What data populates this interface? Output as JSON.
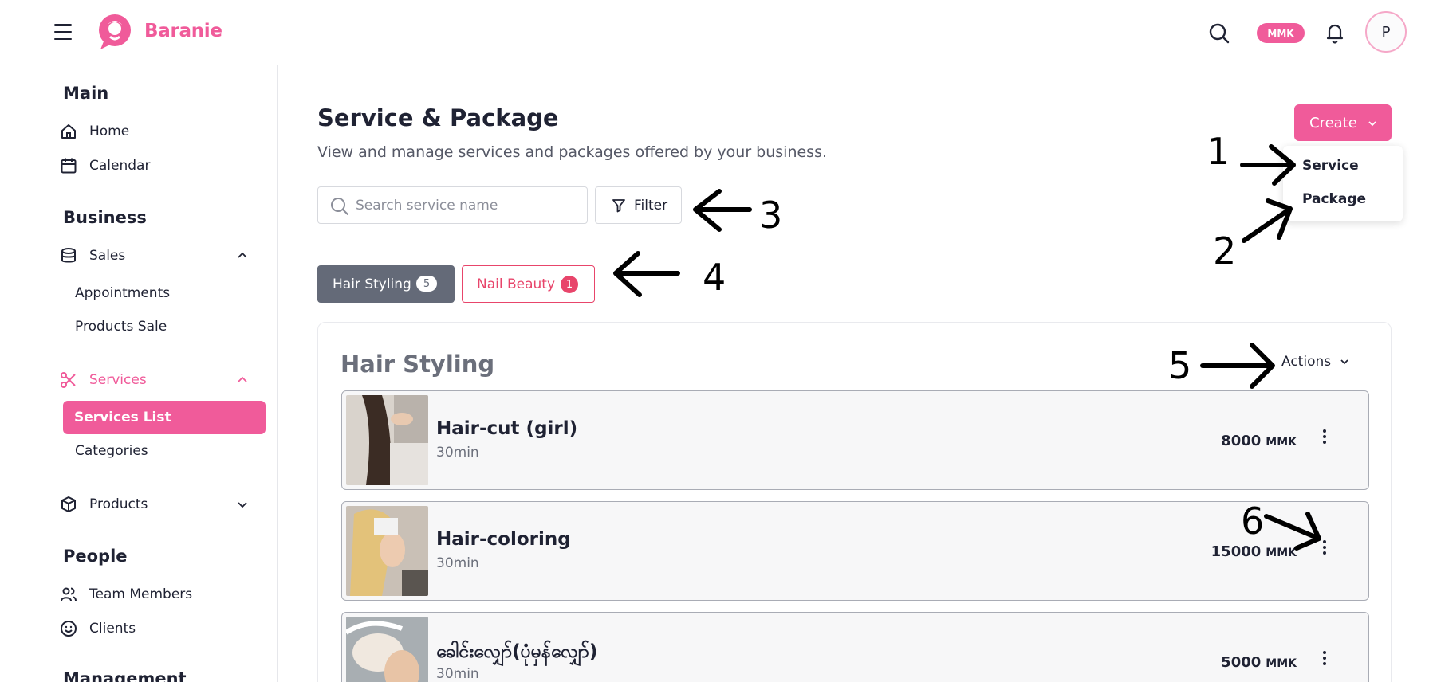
{
  "header": {
    "brand": "Baranie",
    "currency": "MMK",
    "avatar_initial": "P"
  },
  "sidebar": {
    "main_title": "Main",
    "home": "Home",
    "calendar": "Calendar",
    "business_title": "Business",
    "sales": "Sales",
    "appointments": "Appointments",
    "products_sale": "Products Sale",
    "services": "Services",
    "services_list": "Services List",
    "categories": "Categories",
    "products": "Products",
    "people_title": "People",
    "team_members": "Team Members",
    "clients": "Clients",
    "management_title": "Management"
  },
  "page": {
    "title": "Service & Package",
    "subtitle": "View and manage services and packages offered by your business."
  },
  "create": {
    "label": "Create",
    "menu": [
      "Service",
      "Package"
    ]
  },
  "search": {
    "placeholder": "Search service name"
  },
  "filter_label": "Filter",
  "tabs": [
    {
      "label": "Hair Styling",
      "count": "5"
    },
    {
      "label": "Nail Beauty",
      "count": "1"
    }
  ],
  "category": {
    "title": "Hair Styling",
    "actions_label": "Actions"
  },
  "services": [
    {
      "name": "Hair-cut (girl)",
      "duration": "30min",
      "price": "8000",
      "currency": "MMK"
    },
    {
      "name": "Hair-coloring",
      "duration": "30min",
      "price": "15000",
      "currency": "MMK"
    },
    {
      "name": "ခေါင်းလျှော်(ပုံမှန်လျှော်)",
      "duration": "30min",
      "price": "5000",
      "currency": "MMK"
    }
  ],
  "annotations": [
    "1",
    "2",
    "3",
    "4",
    "5",
    "6"
  ],
  "colors": {
    "brand_pink": "#f05b9a",
    "tab_active": "#646a78",
    "tab_outline": "#e8456b"
  }
}
